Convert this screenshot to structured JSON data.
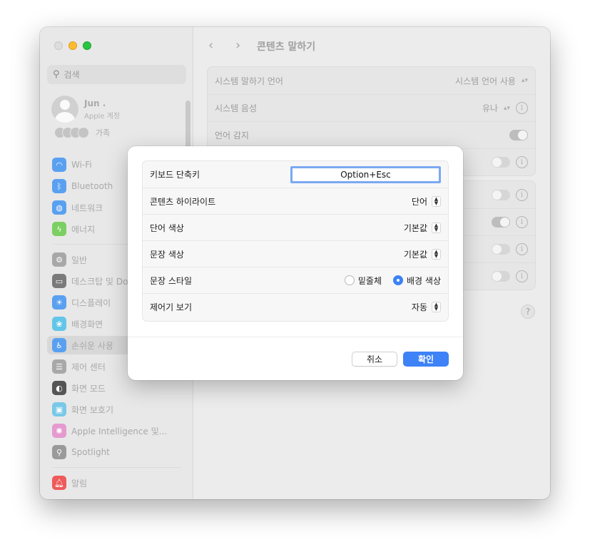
{
  "sidebar": {
    "search_placeholder": "검색",
    "account": {
      "name": "Jun .",
      "subtitle": "Apple 계정"
    },
    "family_label": "가족",
    "items": [
      {
        "label": "Wi-Fi",
        "icon": "wifi-icon",
        "color": "#5aa0f0"
      },
      {
        "label": "Bluetooth",
        "icon": "bluetooth-icon",
        "color": "#5aa0f0"
      },
      {
        "label": "네트워크",
        "icon": "globe-icon",
        "color": "#5aa0f0"
      },
      {
        "label": "에너지",
        "icon": "bolt-icon",
        "color": "#7ccf62"
      },
      {
        "label": "일반",
        "icon": "gear-icon",
        "color": "#a8a8a8"
      },
      {
        "label": "데스크탑 및 Dock",
        "icon": "dock-icon",
        "color": "#7a7a7a"
      },
      {
        "label": "디스플레이",
        "icon": "sun-icon",
        "color": "#5aa0f0"
      },
      {
        "label": "배경화면",
        "icon": "wallpaper-icon",
        "color": "#63c6e8"
      },
      {
        "label": "손쉬운 사용",
        "icon": "accessibility-icon",
        "color": "#5aa0f0"
      },
      {
        "label": "제어 센터",
        "icon": "control-center-icon",
        "color": "#a8a8a8"
      },
      {
        "label": "화면 모드",
        "icon": "appearance-icon",
        "color": "#555555"
      },
      {
        "label": "화면 보호기",
        "icon": "screensaver-icon",
        "color": "#79c8e8"
      },
      {
        "label": "Apple Intelligence 및...",
        "icon": "intelligence-icon",
        "color": "#e59ad0"
      },
      {
        "label": "Spotlight",
        "icon": "spotlight-icon",
        "color": "#9a9a9a"
      },
      {
        "label": "알림",
        "icon": "bell-icon",
        "color": "#ef5a5a"
      }
    ]
  },
  "main": {
    "title": "콘텐츠 말하기",
    "rows": [
      {
        "label": "시스템 말하기 언어",
        "value": "시스템 언어 사용"
      },
      {
        "label": "시스템 음성",
        "value": "유나"
      },
      {
        "label": "언어 감지"
      }
    ]
  },
  "dialog": {
    "rows": [
      {
        "label": "키보드 단축키",
        "value": "Option+Esc"
      },
      {
        "label": "콘텐츠 하이라이트",
        "value": "단어"
      },
      {
        "label": "단어 색상",
        "value": "기본값"
      },
      {
        "label": "문장 색상",
        "value": "기본값"
      },
      {
        "label": "문장 스타일",
        "options": [
          "밑줄체",
          "배경 색상"
        ],
        "selected": "배경 색상"
      },
      {
        "label": "제어기 보기",
        "value": "자동"
      }
    ],
    "cancel_label": "취소",
    "ok_label": "확인"
  },
  "colors": {
    "accent": "#3d82f6",
    "focus_ring": "#7aa9f2"
  }
}
